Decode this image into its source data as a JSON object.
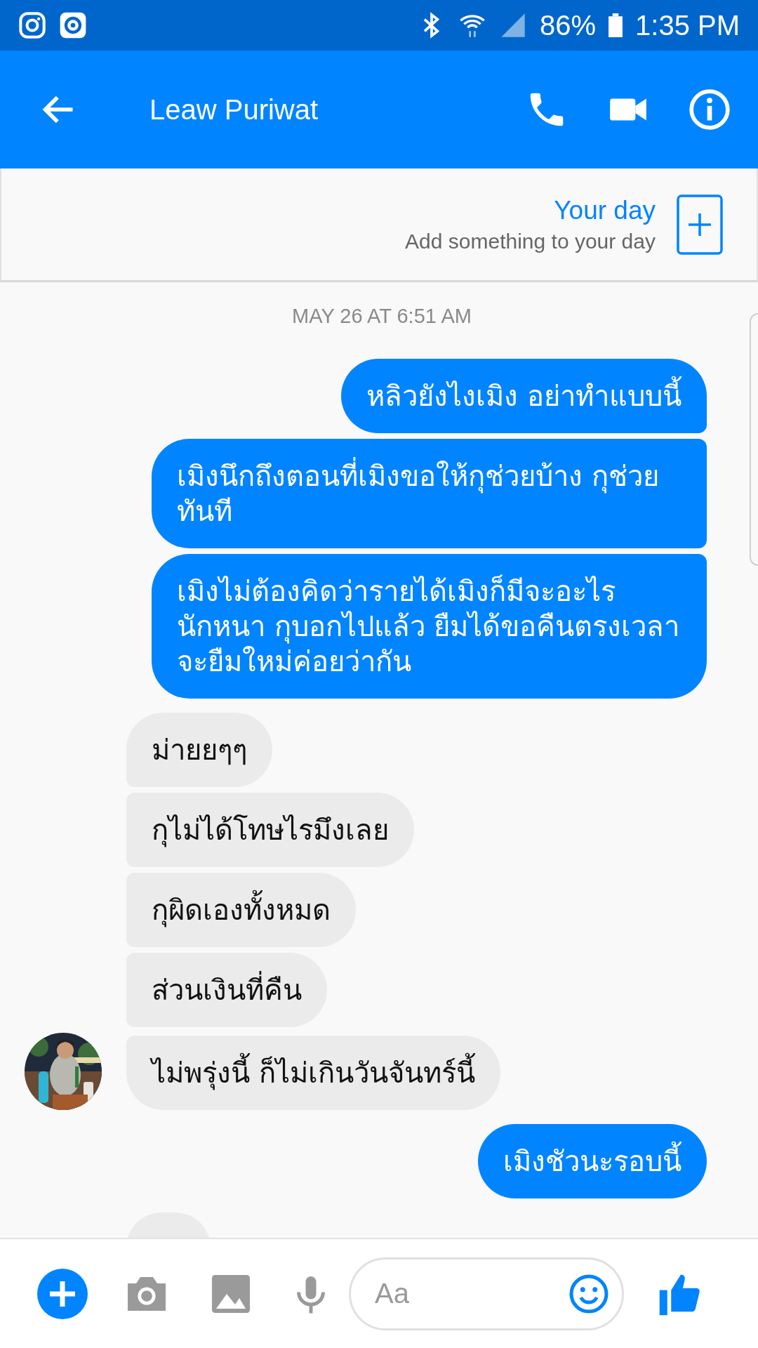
{
  "status_bar": {
    "battery": "86%",
    "time": "1:35 PM"
  },
  "header": {
    "title": "Leaw Puriwat"
  },
  "your_day": {
    "title": "Your day",
    "subtitle": "Add something to your day"
  },
  "timestamp": "MAY 26 AT 6:51 AM",
  "messages": [
    {
      "kind": "sent",
      "text": "หลิวยังไงเมิง อย่าทำแบบนี้"
    },
    {
      "kind": "sent",
      "text": "เมิงนึกถึงตอนที่เมิงขอให้กุช่วยบ้าง กุช่วย ทันที"
    },
    {
      "kind": "sent",
      "text": "เมิงไม่ต้องคิดว่ารายได้เมิงก็มีจะอะไร นักหนา กุบอกไปแล้ว ยืมได้ขอคืนตรงเวลา จะยืมใหม่ค่อยว่ากัน"
    },
    {
      "kind": "received",
      "text": "ม่ายยๆๆ",
      "avatar": false
    },
    {
      "kind": "received",
      "text": "กุไม่ได้โทษไรมึงเลย",
      "avatar": false
    },
    {
      "kind": "received",
      "text": "กุผิดเองทั้งหมด",
      "avatar": false
    },
    {
      "kind": "received",
      "text": "ส่วนเงินที่คืน",
      "avatar": false
    },
    {
      "kind": "received",
      "text": "ไม่พรุ่งนี้ ก็ไม่เกินวันจันทร์นี้",
      "avatar": true
    },
    {
      "kind": "sent",
      "text": "เมิงชัวนะรอบนี้"
    },
    {
      "kind": "received",
      "avatar": false
    }
  ],
  "composer": {
    "placeholder": "Aa"
  }
}
